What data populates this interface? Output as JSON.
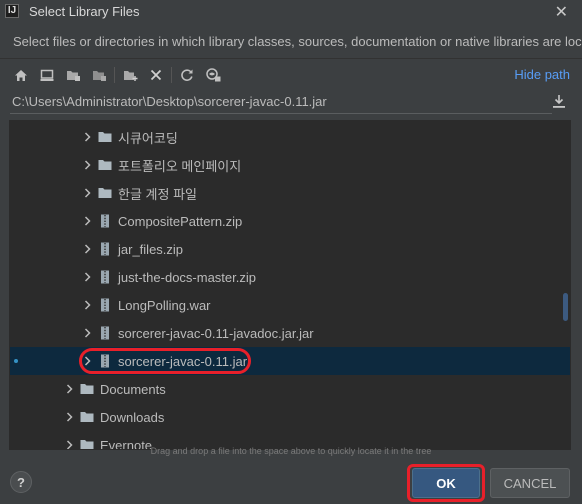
{
  "window": {
    "title": "Select Library Files",
    "app_icon_letter": "IJ"
  },
  "description": "Select files or directories in which library classes, sources, documentation or native libraries are located",
  "toolbar": {
    "icons": [
      "home-icon",
      "desktop-icon",
      "project-folder-icon",
      "module-folder-icon",
      "new-folder-icon",
      "delete-icon",
      "refresh-icon",
      "show-hidden-icon"
    ],
    "hide_path_label": "Hide path"
  },
  "path": {
    "value": "C:\\Users\\Administrator\\Desktop\\sorcerer-javac-0.11.jar"
  },
  "tree": {
    "rows": [
      {
        "label": "시큐어코딩",
        "type": "folder"
      },
      {
        "label": "포트폴리오 메인페이지",
        "type": "folder"
      },
      {
        "label": "한글 계정 파일",
        "type": "folder"
      },
      {
        "label": "CompositePattern.zip",
        "type": "archive"
      },
      {
        "label": "jar_files.zip",
        "type": "archive"
      },
      {
        "label": "just-the-docs-master.zip",
        "type": "archive"
      },
      {
        "label": "LongPolling.war",
        "type": "archive"
      },
      {
        "label": "sorcerer-javac-0.11-javadoc.jar.jar",
        "type": "archive"
      },
      {
        "label": "sorcerer-javac-0.11.jar",
        "type": "archive",
        "selected": true
      },
      {
        "label": "Documents",
        "type": "folder"
      },
      {
        "label": "Downloads",
        "type": "folder"
      },
      {
        "label": "Evernote",
        "type": "folder"
      }
    ]
  },
  "hint": "Drag and drop a file into the space above to quickly locate it in the tree",
  "buttons": {
    "help": "?",
    "ok": "OK",
    "cancel": "CANCEL"
  },
  "colors": {
    "accent": "#589df6",
    "selection": "#0d293e",
    "highlight_ring": "#e8202a",
    "ok_button": "#365880"
  }
}
